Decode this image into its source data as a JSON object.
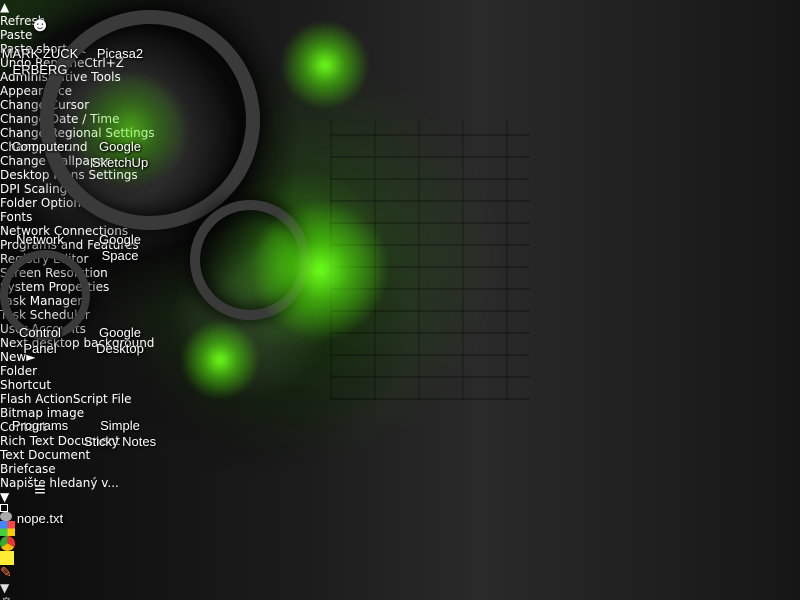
{
  "desktop": {
    "icons": [
      {
        "label": "MARK ZUCKERBERG",
        "icon": "user-icon"
      },
      {
        "label": "Picasa2",
        "icon": "picasa-icon"
      },
      {
        "label": "Computer",
        "icon": "computer-icon"
      },
      {
        "label": "Google SketchUp",
        "icon": "sketchup-icon"
      },
      {
        "label": "Network",
        "icon": "network-icon"
      },
      {
        "label": "Google Space",
        "icon": "google-earth-icon"
      },
      {
        "label": "Control Panel",
        "icon": "control-panel-icon"
      },
      {
        "label": "Google Desktop",
        "icon": "google-desktop-icon"
      },
      {
        "label": "Programs",
        "icon": "folder-icon"
      },
      {
        "label": "Simple Sticky Notes",
        "icon": "sticky-notes-icon"
      },
      {
        "label": "nope.txt",
        "icon": "text-file-icon"
      }
    ]
  },
  "context_menu": {
    "items": [
      {
        "label": "Refresh",
        "enabled": true,
        "shortcut": ""
      },
      {
        "label": "Paste",
        "enabled": false,
        "shortcut": ""
      },
      {
        "label": "Paste shortcut",
        "enabled": false,
        "shortcut": ""
      },
      {
        "label": "Undo Rename",
        "enabled": true,
        "shortcut": "Ctrl+Z"
      },
      {
        "label": "Administrative Tools",
        "enabled": true,
        "shortcut": ""
      },
      {
        "label": "Appearance",
        "enabled": true,
        "shortcut": ""
      },
      {
        "label": "Change Cursor",
        "enabled": true,
        "shortcut": ""
      },
      {
        "label": "Change Date / Time",
        "enabled": true,
        "shortcut": ""
      },
      {
        "label": "Change Regional Settings",
        "enabled": true,
        "shortcut": ""
      },
      {
        "label": "Change Sound",
        "enabled": true,
        "shortcut": ""
      },
      {
        "label": "Change Wallpaper",
        "enabled": true,
        "shortcut": ""
      },
      {
        "label": "Desktop Icons Settings",
        "enabled": true,
        "shortcut": ""
      },
      {
        "label": "DPI Scaling",
        "enabled": true,
        "shortcut": ""
      },
      {
        "label": "Folder Options",
        "enabled": true,
        "shortcut": ""
      },
      {
        "label": "Fonts",
        "enabled": true,
        "shortcut": ""
      },
      {
        "label": "Network Connections",
        "enabled": true,
        "shortcut": ""
      },
      {
        "label": "Programs and Features",
        "enabled": true,
        "shortcut": ""
      },
      {
        "label": "Registry Editor",
        "enabled": true,
        "shortcut": ""
      },
      {
        "label": "Screen Resolution",
        "enabled": true,
        "shortcut": ""
      },
      {
        "label": "System Properties",
        "enabled": true,
        "shortcut": ""
      },
      {
        "label": "Task Manager",
        "enabled": true,
        "shortcut": ""
      },
      {
        "label": "Task Scheduler",
        "enabled": true,
        "shortcut": ""
      },
      {
        "label": "User Accounts",
        "enabled": true,
        "shortcut": ""
      },
      {
        "label": "Next desktop background",
        "enabled": true,
        "shortcut": ""
      },
      {
        "label": "New",
        "enabled": true,
        "shortcut": "",
        "highlighted": true,
        "submenu": true
      }
    ]
  },
  "new_submenu": {
    "items": [
      {
        "label": "Folder",
        "icon": "folder-icon"
      },
      {
        "label": "Shortcut",
        "icon": "shortcut-icon"
      },
      {
        "label": "Flash ActionScript File",
        "icon": "flash-file-icon"
      },
      {
        "label": "Bitmap image",
        "icon": "bitmap-icon"
      },
      {
        "label": "Contact",
        "icon": "contact-icon"
      },
      {
        "label": "Rich Text Document",
        "icon": "rtf-document-icon"
      },
      {
        "label": "Text Document",
        "icon": "text-document-icon"
      },
      {
        "label": "Briefcase",
        "icon": "briefcase-icon"
      }
    ]
  },
  "taskbar": {
    "search_placeholder": "Napište hledaný v...",
    "icons": [
      "start-icon",
      "dropdown-icon",
      "desktop-icon",
      "chat-icon",
      "picasa-icon",
      "chrome-icon",
      "sticky-notes-icon",
      "tool-icon",
      "tray-arrow-icon",
      "settings-icon"
    ]
  },
  "colors": {
    "menu_bg": "#000000",
    "menu_text": "#e6e6e6",
    "menu_disabled": "#2a2a2a",
    "highlight_text": "#3cf03c",
    "wallpaper_accent": "#6cff1a"
  }
}
